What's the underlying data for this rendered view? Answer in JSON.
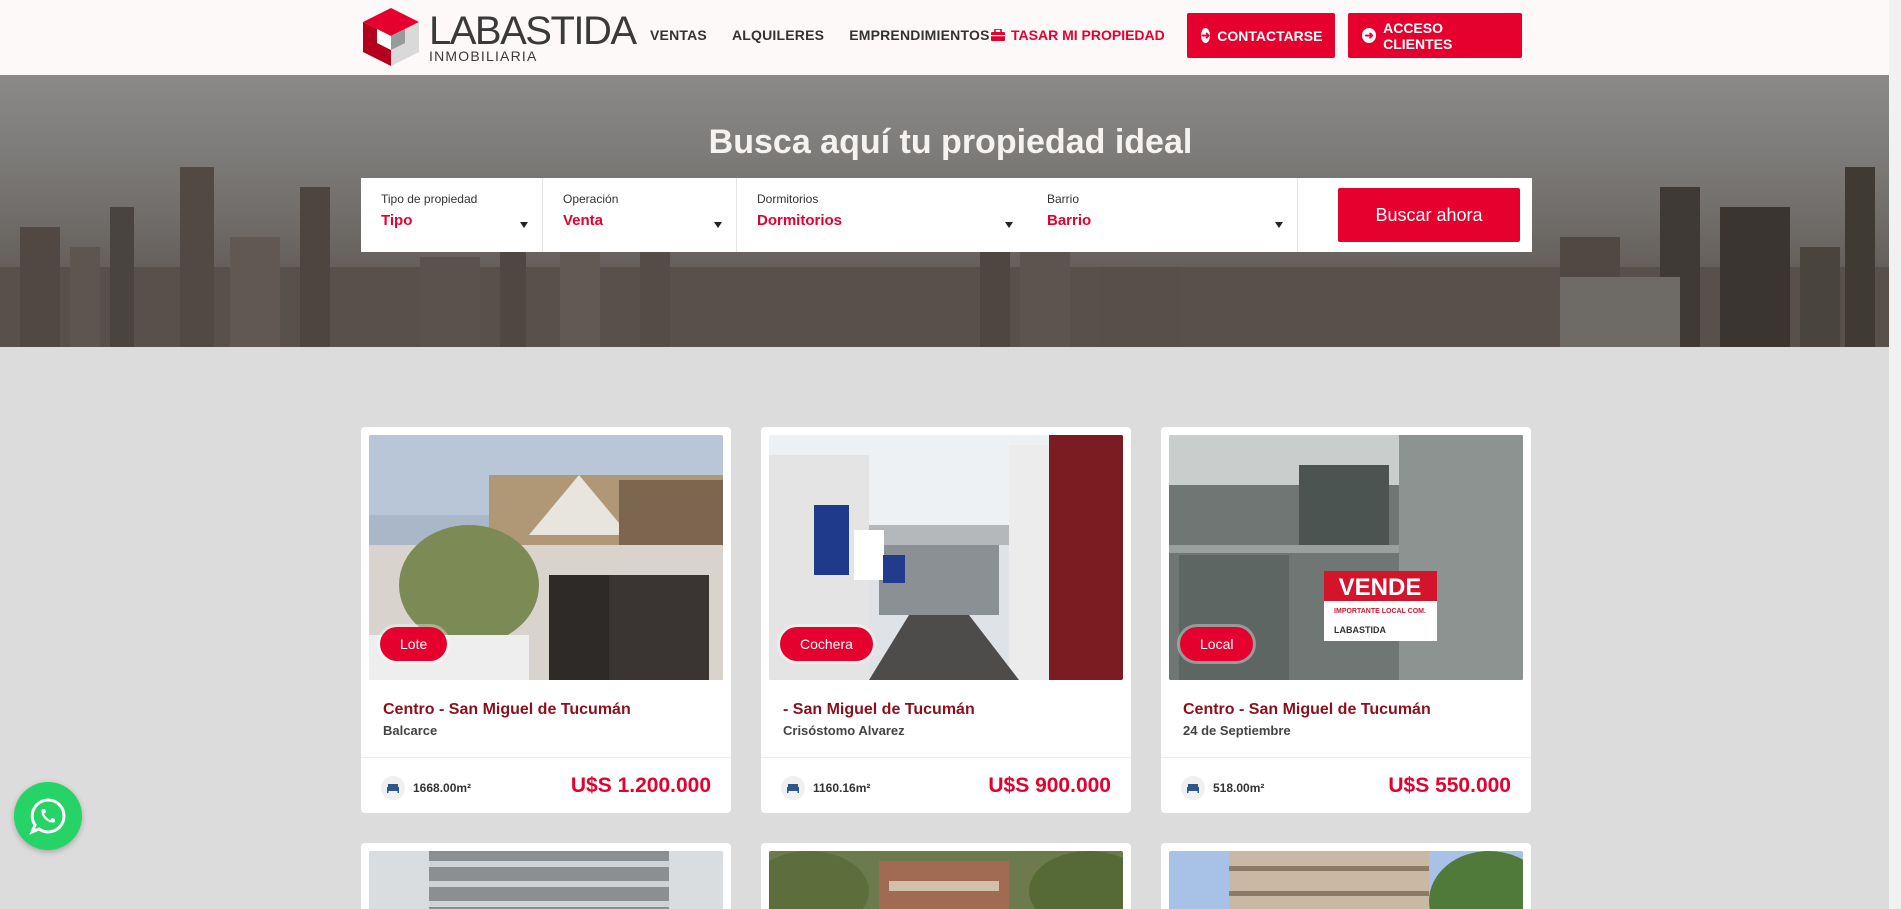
{
  "brand": {
    "name": "LABASTIDA",
    "tagline": "INMOBILIARIA",
    "accent": "#e5002d"
  },
  "nav": {
    "items": [
      {
        "label": "VENTAS"
      },
      {
        "label": "ALQUILERES"
      },
      {
        "label": "EMPRENDIMIENTOS"
      }
    ],
    "tasar_label": "TASAR MI PROPIEDAD",
    "tasar_icon": "toolbox-icon",
    "contact_label": "CONTACTARSE",
    "access_label": "ACCESO CLIENTES",
    "button_icon": "arrow-circle-right-icon"
  },
  "hero": {
    "title": "Busca aquí tu propiedad ideal"
  },
  "search": {
    "fields": [
      {
        "label": "Tipo de propiedad",
        "value": "Tipo"
      },
      {
        "label": "Operación",
        "value": "Venta"
      },
      {
        "label": "Dormitorios",
        "value": "Dormitorios"
      },
      {
        "label": "Barrio",
        "value": "Barrio"
      }
    ],
    "button_label": "Buscar ahora"
  },
  "listings": [
    {
      "badge": "Lote",
      "title": "Centro - San Miguel de Tucumán",
      "street": "Balcarce",
      "area": "1668.00m²",
      "price": "U$S 1.200.000"
    },
    {
      "badge": "Cochera",
      "title": "- San Miguel de Tucumán",
      "street": "Crisóstomo Alvarez",
      "area": "1160.16m²",
      "price": "U$S 900.000"
    },
    {
      "badge": "Local",
      "title": "Centro - San Miguel de Tucumán",
      "street": "24 de Septiembre",
      "area": "518.00m²",
      "price": "U$S 550.000"
    }
  ],
  "photo_text": {
    "vende": "VENDE",
    "vende_sub": "IMPORTANTE LOCAL COM.",
    "sign_brand": "LABASTIDA"
  },
  "whatsapp_icon": "whatsapp-icon"
}
